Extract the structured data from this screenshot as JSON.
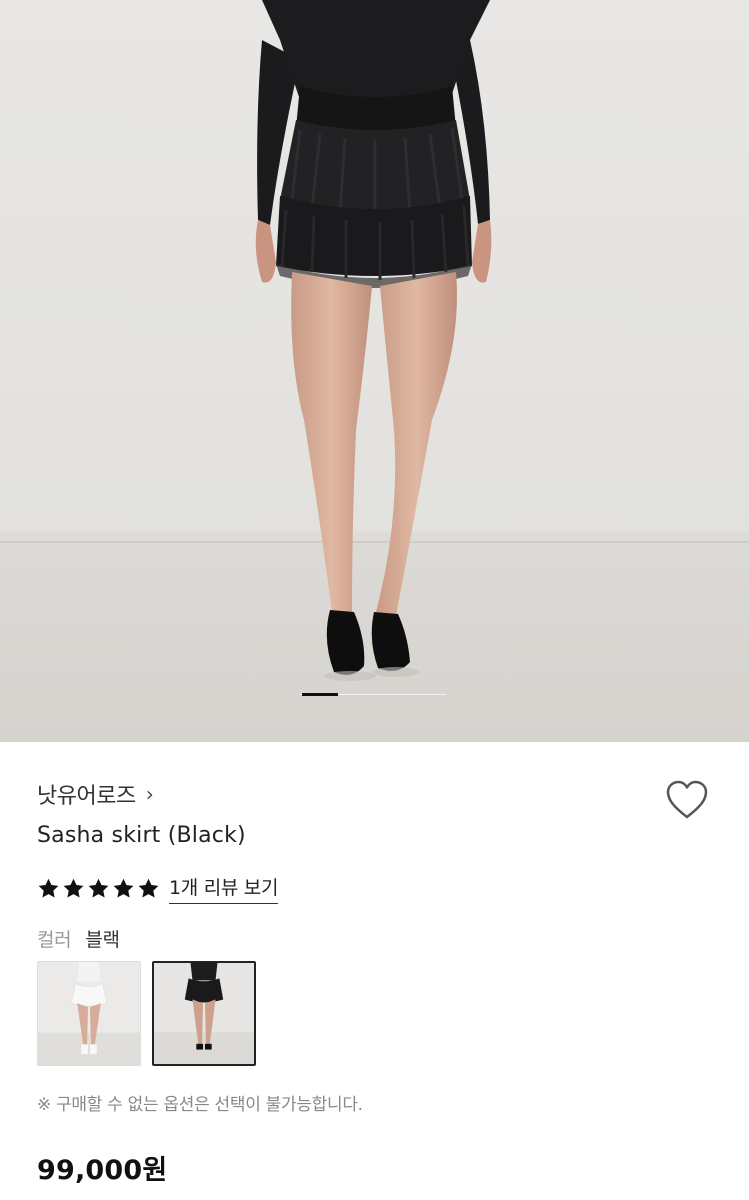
{
  "hero": {
    "image": "black ruffle mini skirt model photo",
    "slide_indicator": {
      "current": 1
    }
  },
  "product": {
    "brand": "낫유어로즈",
    "brand_chevron": "›",
    "name": "Sasha skirt (Black)",
    "rating": {
      "stars": 5,
      "max": 5,
      "review_link": "1개 리뷰 보기"
    },
    "option": {
      "label": "컬러",
      "selected_value": "블랙",
      "swatches": [
        {
          "name": "white",
          "selected": false
        },
        {
          "name": "black",
          "selected": true
        }
      ]
    },
    "notice": "※ 구매할 수 없는 옵션은 선택이 불가능합니다.",
    "price": "99,000원"
  },
  "icons": {
    "wishlist": "heart-outline-icon",
    "star": "star-filled-icon",
    "brand_link": "chevron-right-icon"
  },
  "colors": {
    "text_primary": "#222222",
    "text_muted": "#999999",
    "star": "#111111",
    "background": "#ffffff"
  }
}
